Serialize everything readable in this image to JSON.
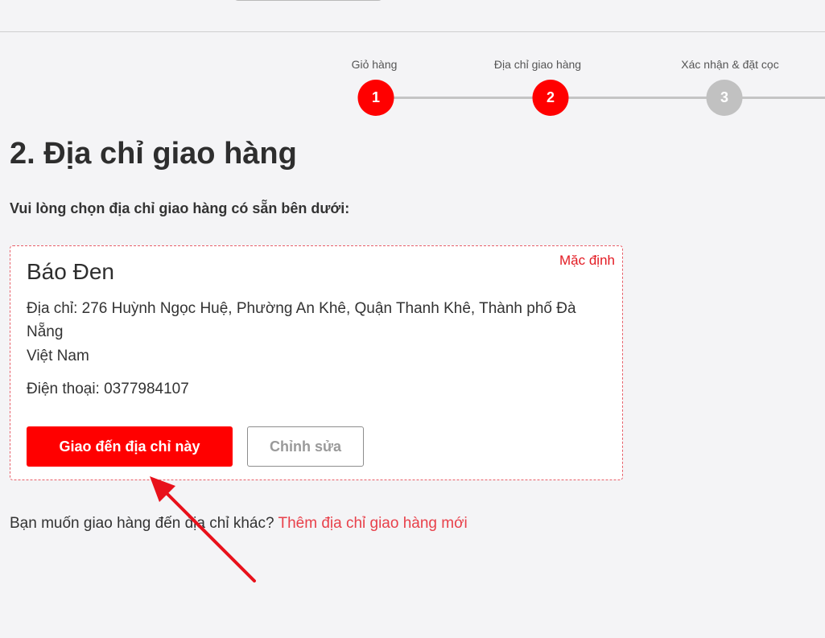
{
  "stepper": {
    "steps": [
      {
        "label": "Giỏ hàng",
        "number": "1",
        "state": "active"
      },
      {
        "label": "Địa chỉ giao hàng",
        "number": "2",
        "state": "active"
      },
      {
        "label": "Xác nhận & đặt cọc",
        "number": "3",
        "state": "inactive"
      }
    ]
  },
  "page": {
    "title": "2. Địa chỉ giao hàng",
    "instruction": "Vui lòng chọn địa chỉ giao hàng có sẵn bên dưới:"
  },
  "address_card": {
    "default_tag": "Mặc định",
    "name": "Báo Đen",
    "address": "Địa chỉ: 276 Huỳnh Ngọc Huệ, Phường An Khê, Quận Thanh Khê, Thành phố Đà Nẵng",
    "country": "Việt Nam",
    "phone": "Điện thoại: 0377984107",
    "deliver_button": "Giao đến địa chỉ này",
    "edit_button": "Chỉnh sửa"
  },
  "footer": {
    "question": "Bạn muốn giao hàng đến địa chỉ khác? ",
    "add_link": "Thêm địa chỉ giao hàng mới"
  },
  "colors": {
    "accent": "#ff0000",
    "inactive_step": "#c1c1c1",
    "link": "#e8404a",
    "annotation_arrow": "#e8111b"
  },
  "annotation": {
    "icon": "red-arrow-icon"
  }
}
